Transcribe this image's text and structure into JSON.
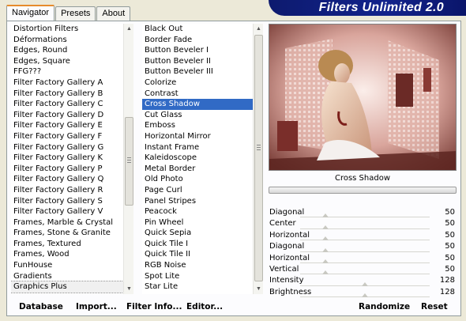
{
  "tabs": [
    {
      "label": "Navigator"
    },
    {
      "label": "Presets"
    },
    {
      "label": "About"
    }
  ],
  "banner": {
    "title": "Filters Unlimited 2.0"
  },
  "categories": {
    "items": [
      "Distortion Filters",
      "Déformations",
      "Edges, Round",
      "Edges, Square",
      "FFG???",
      "Filter Factory Gallery A",
      "Filter Factory Gallery B",
      "Filter Factory Gallery C",
      "Filter Factory Gallery D",
      "Filter Factory Gallery E",
      "Filter Factory Gallery F",
      "Filter Factory Gallery G",
      "Filter Factory Gallery K",
      "Filter Factory Gallery P",
      "Filter Factory Gallery Q",
      "Filter Factory Gallery R",
      "Filter Factory Gallery S",
      "Filter Factory Gallery V",
      "Frames, Marble & Crystal",
      "Frames, Stone & Granite",
      "Frames, Textured",
      "Frames, Wood",
      "FunHouse",
      "Gradients",
      "Graphics Plus"
    ],
    "selected": "Graphics Plus"
  },
  "filters": {
    "items": [
      "Black Out",
      "Border Fade",
      "Button Beveler I",
      "Button Beveler II",
      "Button Beveler III",
      "Colorize",
      "Contrast",
      "Cross Shadow",
      "Cut Glass",
      "Emboss",
      "Horizontal Mirror",
      "Instant Frame",
      "Kaleidoscope",
      "Metal Border",
      "Old Photo",
      "Page Curl",
      "Panel Stripes",
      "Peacock",
      "Pin Wheel",
      "Quick Sepia",
      "Quick Tile I",
      "Quick Tile II",
      "RGB Noise",
      "Spot Lite",
      "Star Lite"
    ],
    "selected": "Cross Shadow"
  },
  "preview": {
    "filter_name": "Cross Shadow"
  },
  "params": [
    {
      "label": "Diagonal",
      "value": "50"
    },
    {
      "label": "Center",
      "value": "50"
    },
    {
      "label": "Horizontal",
      "value": "50"
    },
    {
      "label": "Diagonal",
      "value": "50"
    },
    {
      "label": "Horizontal",
      "value": "50"
    },
    {
      "label": "Vertical",
      "value": "50"
    },
    {
      "label": "Intensity",
      "value": "128"
    },
    {
      "label": "Brightness",
      "value": "128"
    }
  ],
  "buttons": {
    "database": "Database",
    "import": "Import...",
    "filter_info": "Filter Info...",
    "editor": "Editor...",
    "randomize": "Randomize",
    "reset": "Reset"
  },
  "colors": {
    "banner": "#12238c",
    "selection": "#316ac5",
    "tab_highlight": "#e68b2c"
  }
}
